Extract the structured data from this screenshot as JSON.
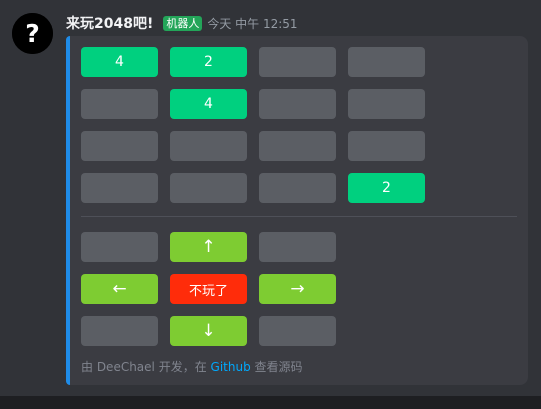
{
  "message": {
    "username": "来玩2048吧!",
    "bot_badge": "机器人",
    "timestamp": "今天 中午 12:51",
    "avatar_glyph": "?"
  },
  "board": {
    "rows": [
      [
        "4",
        "2",
        "",
        ""
      ],
      [
        "",
        "4",
        "",
        ""
      ],
      [
        "",
        "",
        "",
        ""
      ],
      [
        "",
        "",
        "",
        "2"
      ]
    ],
    "colors": {
      "filled": "#00d07f",
      "empty": "#5b5e64"
    }
  },
  "controls": {
    "up": "↑",
    "left": "←",
    "quit": "不玩了",
    "right": "→",
    "down": "↓"
  },
  "footer": {
    "prefix": "由 DeeChael 开发，在 ",
    "link": "Github",
    "suffix": " 查看源码"
  },
  "colors": {
    "accent": "#1f8ce8",
    "move_button": "#7ecc32",
    "quit_button": "#ff2c0a",
    "bot_badge": "#23a559",
    "link": "#00a8fc"
  }
}
